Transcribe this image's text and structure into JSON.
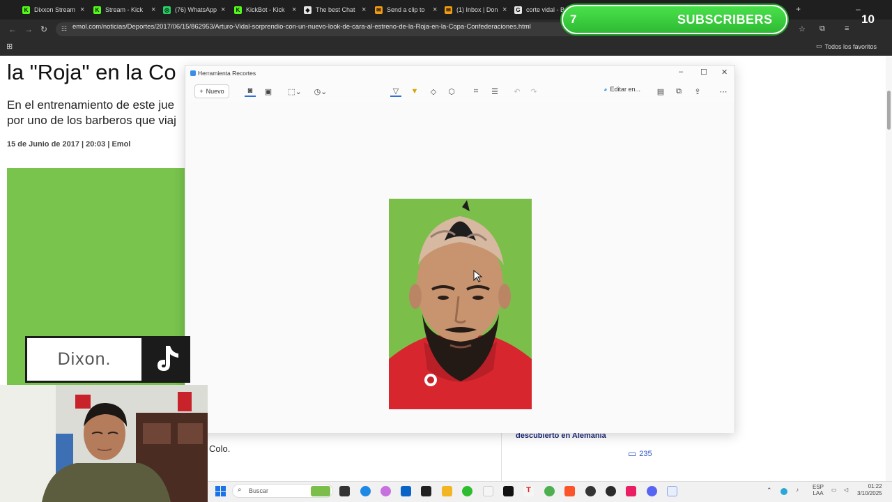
{
  "browser": {
    "tabs": [
      {
        "label": "Dixxon Stream",
        "color": "#53fc18",
        "glyph": "K"
      },
      {
        "label": "Stream - Kick",
        "color": "#53fc18",
        "glyph": "K"
      },
      {
        "label": "(76) WhatsApp",
        "color": "#25d366",
        "glyph": "◎"
      },
      {
        "label": "KickBot - Kick",
        "color": "#53fc18",
        "glyph": "K"
      },
      {
        "label": "The best Chat",
        "color": "#e6e6e6",
        "glyph": "◆"
      },
      {
        "label": "Send a clip to",
        "color": "#f39c12",
        "glyph": "✉"
      },
      {
        "label": "(1) Inbox | Don",
        "color": "#f39c12",
        "glyph": "✉"
      },
      {
        "label": "corte vidal - B",
        "color": "#e6e6e6",
        "glyph": "G"
      }
    ],
    "url": "emol.com/noticias/Deportes/2017/06/15/862953/Arturo-Vidal-sorprendio-con-un-nuevo-look-de-cara-al-estreno-de-la-Roja-en-la-Copa-Confederaciones.html",
    "favorites_label": "Todos los favoritos"
  },
  "overlay": {
    "count": "7",
    "label": "SUBSCRIBERS",
    "target": "10"
  },
  "article": {
    "headline": "la \"Roja\" en la Co",
    "lead_line1": "En el entrenamiento de este jue",
    "lead_line2": "por uno de los barberos que viaj",
    "dateline": "15 de Junio de 2017 | 20:03 | Emol",
    "caption_tail": "Colo.",
    "related_title": "descubierto en Alemania",
    "comments_count": "235"
  },
  "snipping_tool": {
    "title": "Herramienta Recortes",
    "new_button": "Nuevo",
    "edit_in": "Editar en..."
  },
  "stream_badge": {
    "name": "Dixon."
  },
  "taskbar": {
    "search_placeholder": "Buscar",
    "language_top": "ESP",
    "language_bottom": "LAA",
    "time": "01:22",
    "date": "3/10/2025"
  },
  "colors": {
    "accent": "#2f6fd6",
    "overlay_green": "#3ccf3f",
    "image_green": "#7bbf4a",
    "jersey_red": "#d8262f"
  }
}
